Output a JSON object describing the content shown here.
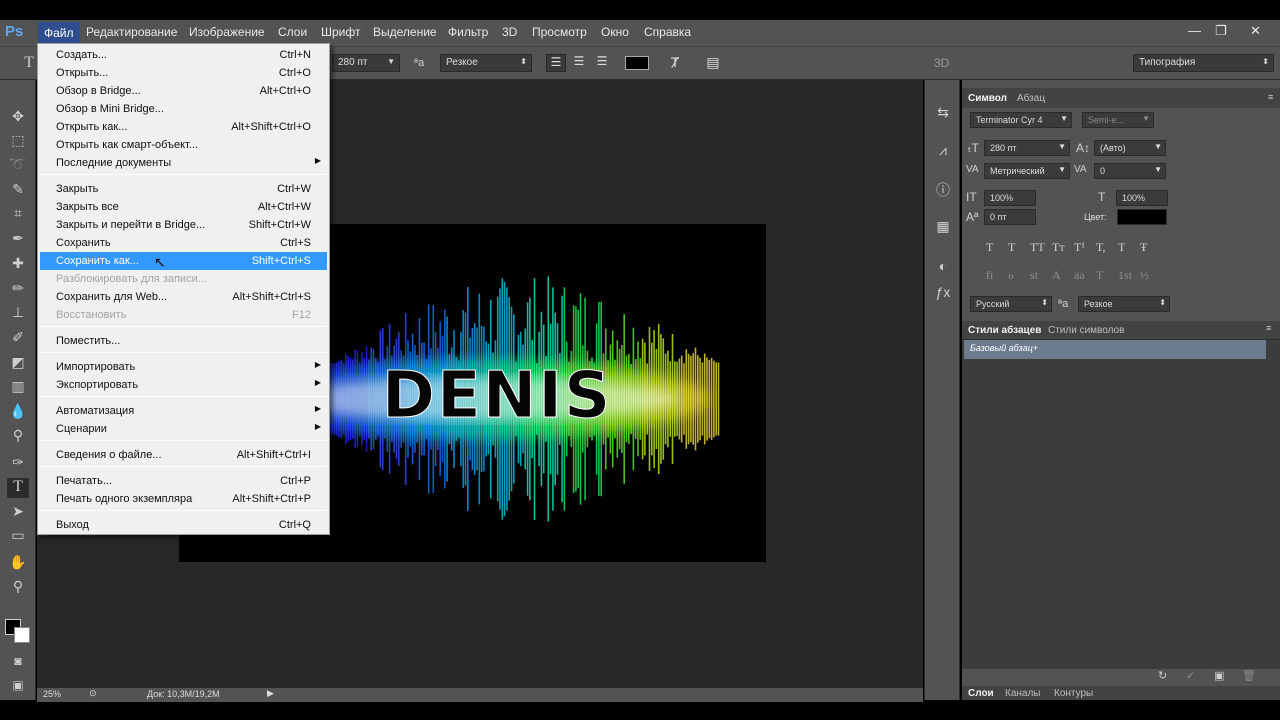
{
  "app": {
    "logo": "Ps",
    "menu": [
      "Файл",
      "Редактирование",
      "Изображение",
      "Слои",
      "Шрифт",
      "Выделение",
      "Фильтр",
      "3D",
      "Просмотр",
      "Окно",
      "Справка"
    ],
    "window_controls": [
      "—",
      "❐",
      "✕"
    ]
  },
  "options_bar": {
    "font_size": "280 пт",
    "antialias": "Резкое",
    "mode_3d": "3D",
    "workspace": "Типография",
    "text_tool_icon": "text-tool-icon"
  },
  "file_menu": {
    "items": [
      {
        "label": "Создать...",
        "shortcut": "Ctrl+N",
        "state": "normal"
      },
      {
        "label": "Открыть...",
        "shortcut": "Ctrl+O",
        "state": "normal"
      },
      {
        "label": "Обзор в Bridge...",
        "shortcut": "Alt+Ctrl+O",
        "state": "normal"
      },
      {
        "label": "Обзор в Mini Bridge...",
        "shortcut": "",
        "state": "normal"
      },
      {
        "label": "Открыть как...",
        "shortcut": "Alt+Shift+Ctrl+O",
        "state": "normal"
      },
      {
        "label": "Открыть как смарт-объект...",
        "shortcut": "",
        "state": "normal"
      },
      {
        "label": "Последние документы",
        "shortcut": "",
        "state": "submenu"
      },
      {
        "label": "Закрыть",
        "shortcut": "Ctrl+W",
        "state": "normal"
      },
      {
        "label": "Закрыть все",
        "shortcut": "Alt+Ctrl+W",
        "state": "normal"
      },
      {
        "label": "Закрыть и перейти в Bridge...",
        "shortcut": "Shift+Ctrl+W",
        "state": "normal"
      },
      {
        "label": "Сохранить",
        "shortcut": "Ctrl+S",
        "state": "normal"
      },
      {
        "label": "Сохранить как...",
        "shortcut": "Shift+Ctrl+S",
        "state": "highlighted"
      },
      {
        "label": "Разблокировать для записи...",
        "shortcut": "",
        "state": "disabled"
      },
      {
        "label": "Сохранить для Web...",
        "shortcut": "Alt+Shift+Ctrl+S",
        "state": "normal"
      },
      {
        "label": "Восстановить",
        "shortcut": "F12",
        "state": "disabled"
      },
      {
        "label": "Поместить...",
        "shortcut": "",
        "state": "normal"
      },
      {
        "label": "Импортировать",
        "shortcut": "",
        "state": "submenu"
      },
      {
        "label": "Экспортировать",
        "shortcut": "",
        "state": "submenu"
      },
      {
        "label": "Автоматизация",
        "shortcut": "",
        "state": "submenu"
      },
      {
        "label": "Сценарии",
        "shortcut": "",
        "state": "submenu"
      },
      {
        "label": "Сведения о файле...",
        "shortcut": "Alt+Shift+Ctrl+I",
        "state": "normal"
      },
      {
        "label": "Печатать...",
        "shortcut": "Ctrl+P",
        "state": "normal"
      },
      {
        "label": "Печать одного экземпляра",
        "shortcut": "Alt+Shift+Ctrl+P",
        "state": "normal"
      },
      {
        "label": "Выход",
        "shortcut": "Ctrl+Q",
        "state": "normal"
      }
    ]
  },
  "canvas": {
    "text": "DENIS",
    "zoom": "25%",
    "doc_info": "Док: 10,3M/19,2M"
  },
  "character_panel": {
    "tabs": [
      "Символ",
      "Абзац"
    ],
    "font_family": "Terminator Cyr 4",
    "font_style": "Semi-e...",
    "size": "280 пт",
    "leading": "(Авто)",
    "kerning": "Метрический",
    "tracking": "0",
    "vertical_scale": "100%",
    "horizontal_scale": "100%",
    "baseline_shift": "0 пт",
    "color_label": "Цвет:",
    "color": "#000000",
    "language": "Русский",
    "antialias": "Резкое",
    "typo_row1": [
      "T",
      "T",
      "TT",
      "Tт",
      "T¹",
      "T,",
      "T",
      "Ŧ"
    ],
    "typo_row2": [
      "fi",
      "ℴ",
      "st",
      "A",
      "aa",
      "T",
      "1st",
      "½"
    ]
  },
  "styles_panel": {
    "tabs": [
      "Стили абзацев",
      "Стили символов"
    ],
    "selected_style": "Базовый абзац+"
  },
  "layers_panel": {
    "tabs": [
      "Слои",
      "Каналы",
      "Контуры"
    ]
  }
}
